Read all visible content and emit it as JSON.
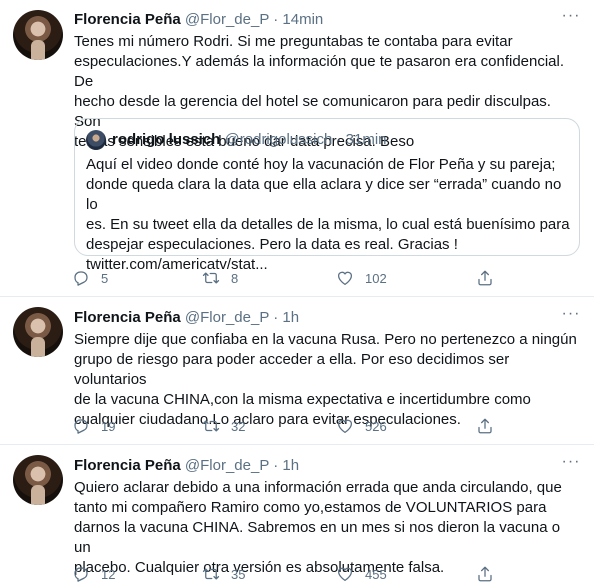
{
  "colors": {
    "text": "#0f1419",
    "secondary": "#5b7083",
    "border": "#e6ecf0"
  },
  "icons": {
    "reply": "reply-icon",
    "retweet": "retweet-icon",
    "like": "heart-icon",
    "share": "share-icon",
    "more": "more-dots-icon"
  },
  "tweets": [
    {
      "name": "Florencia Peña",
      "handle": "@Flor_de_P",
      "dot": "·",
      "time": "14min",
      "text": "Tenes mi número Rodri. Si me preguntabas te contaba para evitar\nespeculaciones.Y además la información que te pasaron era confidencial. De\nhecho desde la gerencia del hotel se comunicaron para pedir disculpas. Son\ntemas sensibles esta bueno dar data precisa. Beso",
      "quote": {
        "name": "rodrigo lussich",
        "handle": "@rodrigolussich",
        "dot": "·",
        "time": "31min",
        "text": "Aquí el video donde conté hoy la vacunación de Flor Peña y su pareja;\ndonde queda clara la data que ella aclara y dice ser “errada” cuando no lo\nes. En su tweet ella da detalles de la misma, lo cual está buenísimo para\ndespejar especulaciones. Pero la data es real. Gracias !\ntwitter.com/americatv/stat..."
      },
      "replies": "5",
      "retweets": "8",
      "likes": "102"
    },
    {
      "name": "Florencia Peña",
      "handle": "@Flor_de_P",
      "dot": "·",
      "time": "1h",
      "text": "Siempre dije que confiaba en la vacuna Rusa. Pero no pertenezco a ningún\ngrupo de riesgo para poder acceder a ella. Por eso decidimos ser voluntarios\nde la vacuna CHINA,con la misma expectativa e incertidumbre como\ncualquier ciudadano.Lo aclaro para evitar especulaciones.",
      "replies": "19",
      "retweets": "32",
      "likes": "526"
    },
    {
      "name": "Florencia Peña",
      "handle": "@Flor_de_P",
      "dot": "·",
      "time": "1h",
      "text": "Quiero aclarar debido a una información errada que anda circulando, que\ntanto mi compañero Ramiro como yo,estamos de VOLUNTARIOS  para\ndarnos la vacuna CHINA. Sabremos en un mes si nos dieron la vacuna o un\nplacebo. Cualquier otra versión es absolutamente falsa.",
      "replies": "12",
      "retweets": "35",
      "likes": "455"
    }
  ]
}
